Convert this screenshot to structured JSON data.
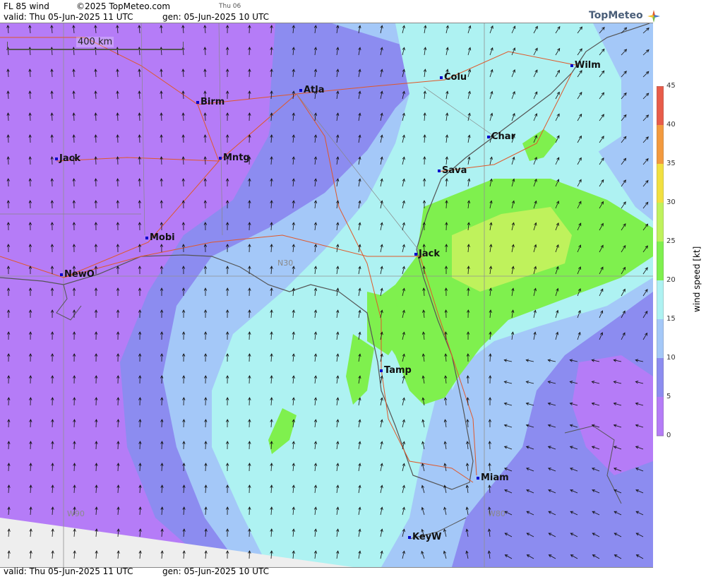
{
  "header": {
    "product": "FL 85 wind",
    "copyright": "©2025 TopMeteo.com",
    "day_tag": "Thu 06",
    "valid": "valid:  Thu  05-Jun-2025  11 UTC",
    "gen": "gen: 05-Jun-2025 10 UTC",
    "logo": "TopMeteo"
  },
  "footer": {
    "valid": "valid:  Thu  05-Jun-2025  11 UTC",
    "gen": "gen: 05-Jun-2025 10 UTC"
  },
  "map": {
    "scale_label": "400 km",
    "grid_labels": {
      "lat": "N30",
      "lon_west": "W90",
      "lon_east": "W80"
    },
    "cities": [
      {
        "name": "Birm"
      },
      {
        "name": "Atla"
      },
      {
        "name": "Colu"
      },
      {
        "name": "Wilm"
      },
      {
        "name": "Jack"
      },
      {
        "name": "Mntg"
      },
      {
        "name": "Char"
      },
      {
        "name": "Sava"
      },
      {
        "name": "Mobi"
      },
      {
        "name": "NewO"
      },
      {
        "name": "Jack"
      },
      {
        "name": "Tamp"
      },
      {
        "name": "Miam"
      },
      {
        "name": "KeyW"
      }
    ]
  },
  "legend": {
    "title": "wind speed [kt]",
    "ticks": [
      "45",
      "40",
      "35",
      "30",
      "25",
      "20",
      "15",
      "10",
      "5",
      "0"
    ],
    "colors": [
      "#e85c4a",
      "#f39a3e",
      "#f2e040",
      "#bff25c",
      "#7ff04e",
      "#aef2f2",
      "#a4c8f8",
      "#8c8cf0",
      "#b57cf7"
    ]
  }
}
